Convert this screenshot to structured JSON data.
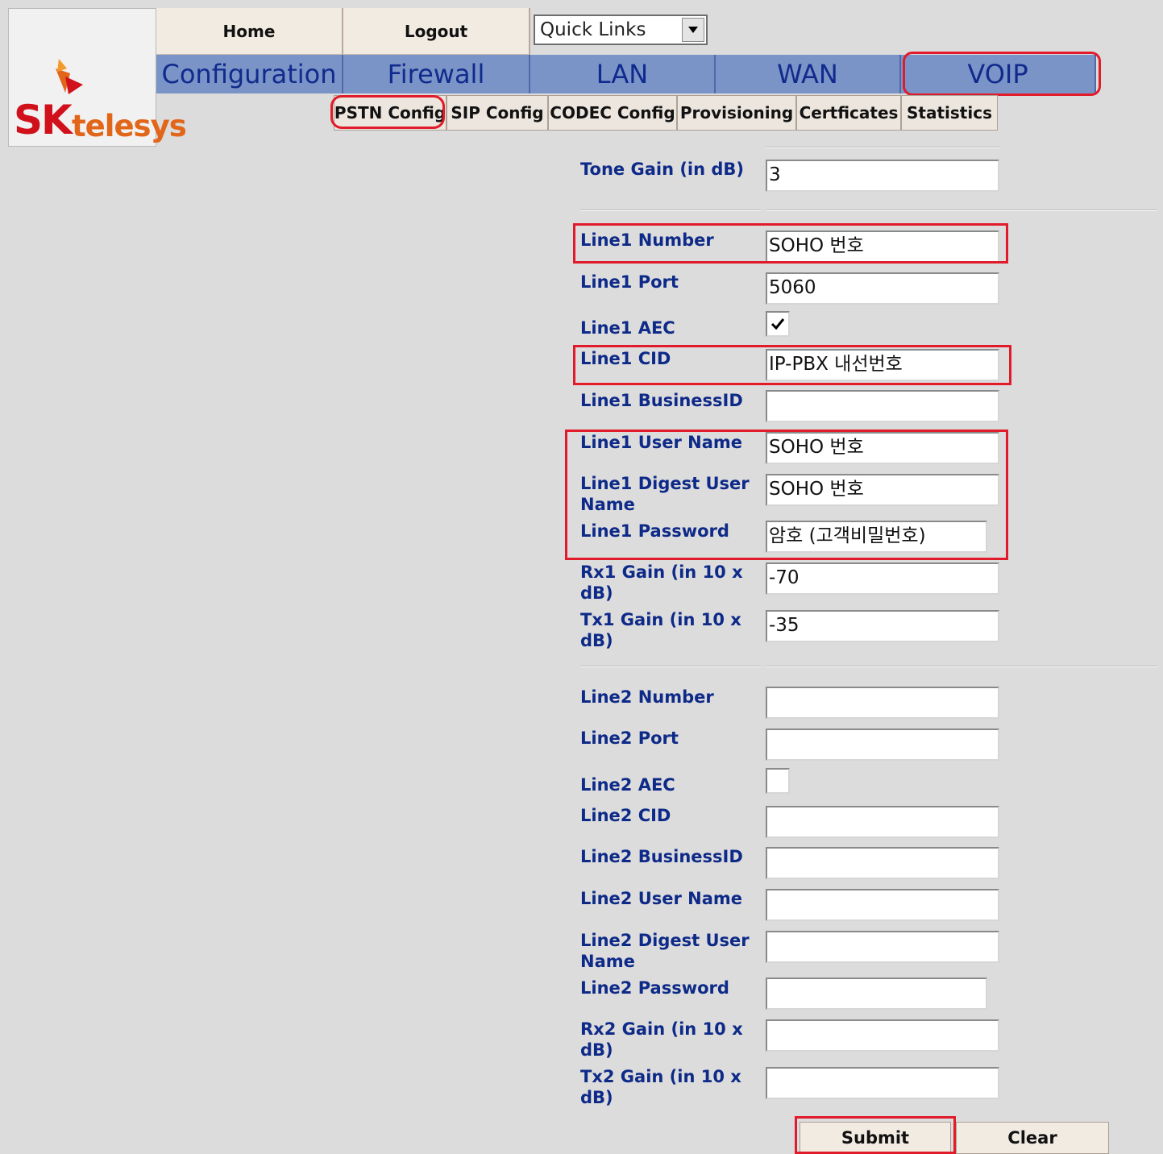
{
  "logo": {
    "brand_sk": "SK",
    "brand_telesys": "telesys",
    "color_red": "#d0111b",
    "color_orange": "#e2661a"
  },
  "top_buttons": {
    "home": "Home",
    "logout": "Logout"
  },
  "quick_links": {
    "selected": "Quick Links"
  },
  "nav": [
    "Configuration",
    "Firewall",
    "LAN",
    "WAN",
    "VOIP"
  ],
  "sub_tabs": [
    "PSTN Config",
    "SIP Config",
    "CODEC Config",
    "Provisioning",
    "Certficates",
    "Statistics"
  ],
  "form": {
    "tone_gain": {
      "label": "Tone Gain (in dB)",
      "value": "3"
    },
    "line1": {
      "number": {
        "label": "Line1 Number",
        "value": "SOHO 번호"
      },
      "port": {
        "label": "Line1 Port",
        "value": "5060"
      },
      "aec": {
        "label": "Line1 AEC",
        "checked": true
      },
      "cid": {
        "label": "Line1 CID",
        "value": "IP-PBX 내선번호"
      },
      "business_id": {
        "label": "Line1 BusinessID",
        "value": ""
      },
      "user_name": {
        "label": "Line1 User Name",
        "value": "SOHO 번호"
      },
      "digest_user": {
        "label_1": "Line1 Digest User",
        "label_2": "Name",
        "value": "SOHO 번호"
      },
      "password": {
        "label": "Line1 Password",
        "value": "암호 (고객비밀번호)"
      },
      "rx_gain": {
        "label_1": "Rx1 Gain (in 10 x",
        "label_2": "dB)",
        "value": "-70"
      },
      "tx_gain": {
        "label_1": "Tx1 Gain (in 10 x",
        "label_2": "dB)",
        "value": "-35"
      }
    },
    "line2": {
      "number": {
        "label": "Line2 Number",
        "value": ""
      },
      "port": {
        "label": "Line2 Port",
        "value": ""
      },
      "aec": {
        "label": "Line2 AEC",
        "checked": false
      },
      "cid": {
        "label": "Line2 CID",
        "value": ""
      },
      "business_id": {
        "label": "Line2 BusinessID",
        "value": ""
      },
      "user_name": {
        "label": "Line2 User Name",
        "value": ""
      },
      "digest_user": {
        "label_1": "Line2 Digest User",
        "label_2": "Name",
        "value": ""
      },
      "password": {
        "label": "Line2 Password",
        "value": ""
      },
      "rx_gain": {
        "label_1": "Rx2 Gain (in 10 x",
        "label_2": "dB)",
        "value": ""
      },
      "tx_gain": {
        "label_1": "Tx2 Gain (in 10 x",
        "label_2": "dB)",
        "value": ""
      }
    }
  },
  "actions": {
    "submit": "Submit",
    "clear": "Clear"
  },
  "colors": {
    "nav_bg": "#7a94c7",
    "nav_text": "#112a8d",
    "label_text": "#0e2a88",
    "highlight": "#e11b2a",
    "page_bg": "#dcdcdc"
  }
}
